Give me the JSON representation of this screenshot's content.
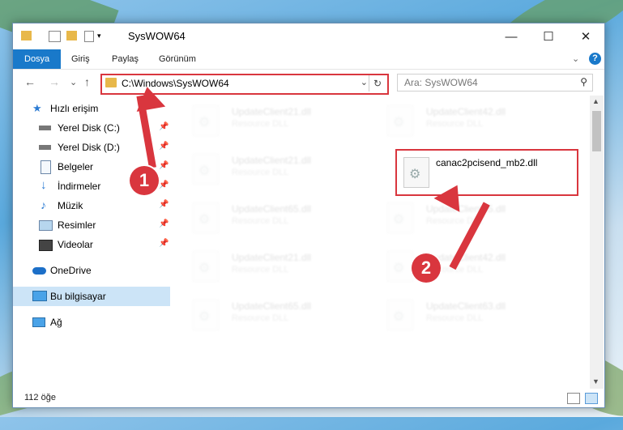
{
  "window": {
    "title": "SysWOW64",
    "minimize_label": "—",
    "maximize_label": "☐",
    "close_label": "✕"
  },
  "ribbon": {
    "tabs": [
      {
        "label": "Dosya"
      },
      {
        "label": "Giriş"
      },
      {
        "label": "Paylaş"
      },
      {
        "label": "Görünüm"
      }
    ],
    "collapse_label": "⌄",
    "help_label": "?"
  },
  "nav": {
    "back_label": "←",
    "forward_label": "→",
    "recent_label": "⌄",
    "up_label": "↑",
    "address_path": "C:\\Windows\\SysWOW64",
    "address_dropdown": "⌄",
    "refresh_label": "↻",
    "search_placeholder": "Ara: SysWOW64",
    "search_icon": "⚲"
  },
  "sidebar": {
    "items": [
      {
        "label": "Hızlı erişim",
        "icon": "star-icon",
        "pinned": false
      },
      {
        "label": "Yerel Disk (C:)",
        "icon": "disk-icon",
        "pinned": true
      },
      {
        "label": "Yerel Disk (D:)",
        "icon": "disk-icon",
        "pinned": true
      },
      {
        "label": "Belgeler",
        "icon": "documents-icon",
        "pinned": true
      },
      {
        "label": "İndirmeler",
        "icon": "download-icon",
        "pinned": true
      },
      {
        "label": "Müzik",
        "icon": "music-icon",
        "pinned": true
      },
      {
        "label": "Resimler",
        "icon": "pictures-icon",
        "pinned": true
      },
      {
        "label": "Videolar",
        "icon": "videos-icon",
        "pinned": true
      },
      {
        "label": "OneDrive",
        "icon": "cloud-icon",
        "pinned": false
      },
      {
        "label": "Bu bilgisayar",
        "icon": "computer-icon",
        "pinned": false
      },
      {
        "label": "Ağ",
        "icon": "network-icon",
        "pinned": false
      }
    ],
    "pin_glyph": "📌"
  },
  "files": {
    "col1": [
      {
        "name": "UpdateClient21.dll",
        "type": "Resource DLL"
      },
      {
        "name": "UpdateClient21.dll",
        "type": "Resource DLL"
      },
      {
        "name": "UpdateClient65.dll",
        "type": "Resource DLL"
      },
      {
        "name": "UpdateClient21.dll",
        "type": "Resource DLL"
      },
      {
        "name": "UpdateClient65.dll",
        "type": "Resource DLL"
      }
    ],
    "col2": [
      {
        "name": "UpdateClient42.dll",
        "type": "Resource DLL"
      },
      {
        "name": "canac2pcisend_mb2.dll",
        "type": ""
      },
      {
        "name": "UpdateClient65.dll",
        "type": "Resource DLL"
      },
      {
        "name": "UpdateClient42.dll",
        "type": "Resource DLL"
      },
      {
        "name": "UpdateClient63.dll",
        "type": "Resource DLL"
      }
    ]
  },
  "status": {
    "count": "112 öğe"
  },
  "annotations": {
    "marker1": "1",
    "marker2": "2",
    "color": "#d9363e"
  }
}
